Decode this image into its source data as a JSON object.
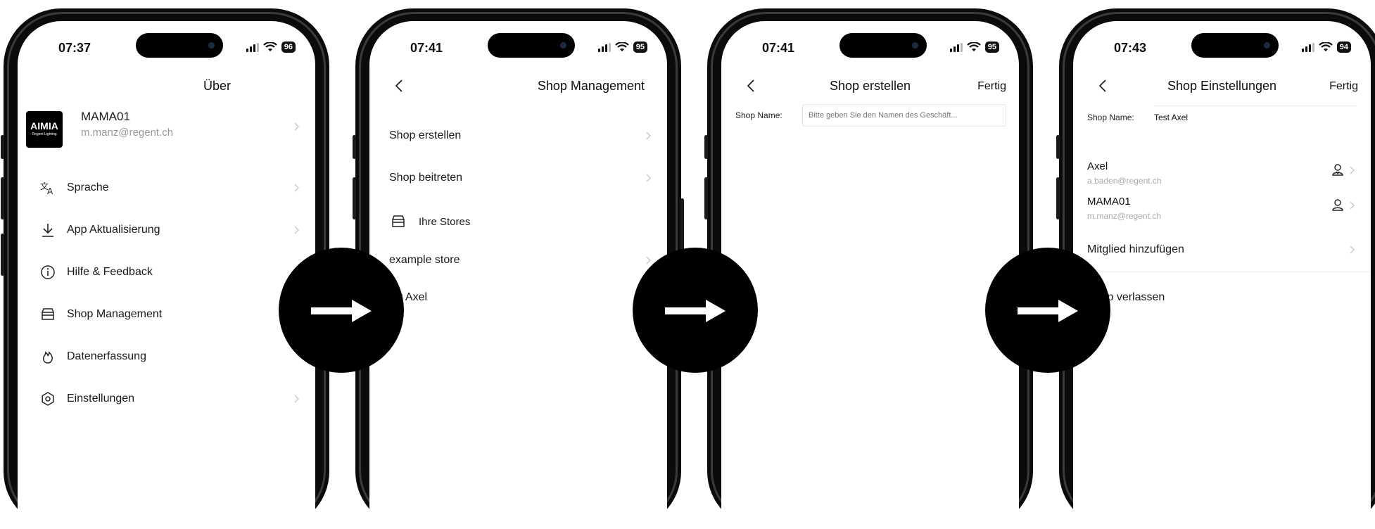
{
  "screens": [
    {
      "time": "07:37",
      "battery": "96",
      "title": "Über",
      "profile": {
        "logo_text": "AIMIA",
        "logo_sub": "Regent Lighting",
        "name": "MAMA01",
        "email": "m.manz@regent.ch"
      },
      "menu": [
        {
          "icon": "translate-icon",
          "label": "Sprache"
        },
        {
          "icon": "download-icon",
          "label": "App Aktualisierung"
        },
        {
          "icon": "info-icon",
          "label": "Hilfe & Feedback"
        },
        {
          "icon": "store-icon",
          "label": "Shop Management"
        },
        {
          "icon": "fire-icon",
          "label": "Datenerfassung"
        },
        {
          "icon": "settings-icon",
          "label": "Einstellungen"
        }
      ]
    },
    {
      "time": "07:41",
      "battery": "95",
      "title": "Shop Management",
      "items": [
        "Shop erstellen",
        "Shop beitreten"
      ],
      "section": "Ihre Stores",
      "stores": [
        "example store",
        "Test Axel"
      ]
    },
    {
      "time": "07:41",
      "battery": "95",
      "title": "Shop erstellen",
      "done": "Fertig",
      "field_label": "Shop Name:",
      "field_placeholder": "Bitte geben Sie den Namen des Geschäft..."
    },
    {
      "time": "07:43",
      "battery": "94",
      "title": "Shop Einstellungen",
      "done": "Fertig",
      "field_label": "Shop Name:",
      "field_value": "Test Axel",
      "members": [
        {
          "name": "Axel",
          "email": "a.baden@regent.ch"
        },
        {
          "name": "MAMA01",
          "email": "m.manz@regent.ch"
        }
      ],
      "add_member": "Mitglied hinzufügen",
      "leave": "Shop verlassen"
    }
  ]
}
